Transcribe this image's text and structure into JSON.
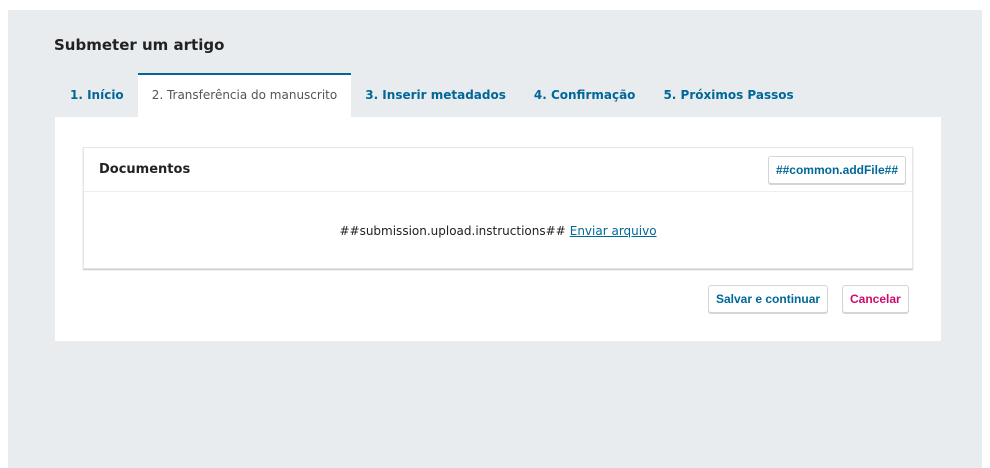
{
  "page": {
    "title": "Submeter um artigo"
  },
  "tabs": [
    {
      "label": "1. Início",
      "active": false
    },
    {
      "label": "2. Transferência do manuscrito",
      "active": true
    },
    {
      "label": "3. Inserir metadados",
      "active": false
    },
    {
      "label": "4. Confirmação",
      "active": false
    },
    {
      "label": "5. Próximos Passos",
      "active": false
    }
  ],
  "documents": {
    "title": "Documentos",
    "add_file_label": "##common.addFile##",
    "instructions": "##submission.upload.instructions##",
    "upload_link": "Enviar arquivo"
  },
  "actions": {
    "save_label": "Salvar e continuar",
    "cancel_label": "Cancelar"
  },
  "colors": {
    "accent": "#006798",
    "cancel": "#d00a6c",
    "background": "#e9ecee"
  }
}
